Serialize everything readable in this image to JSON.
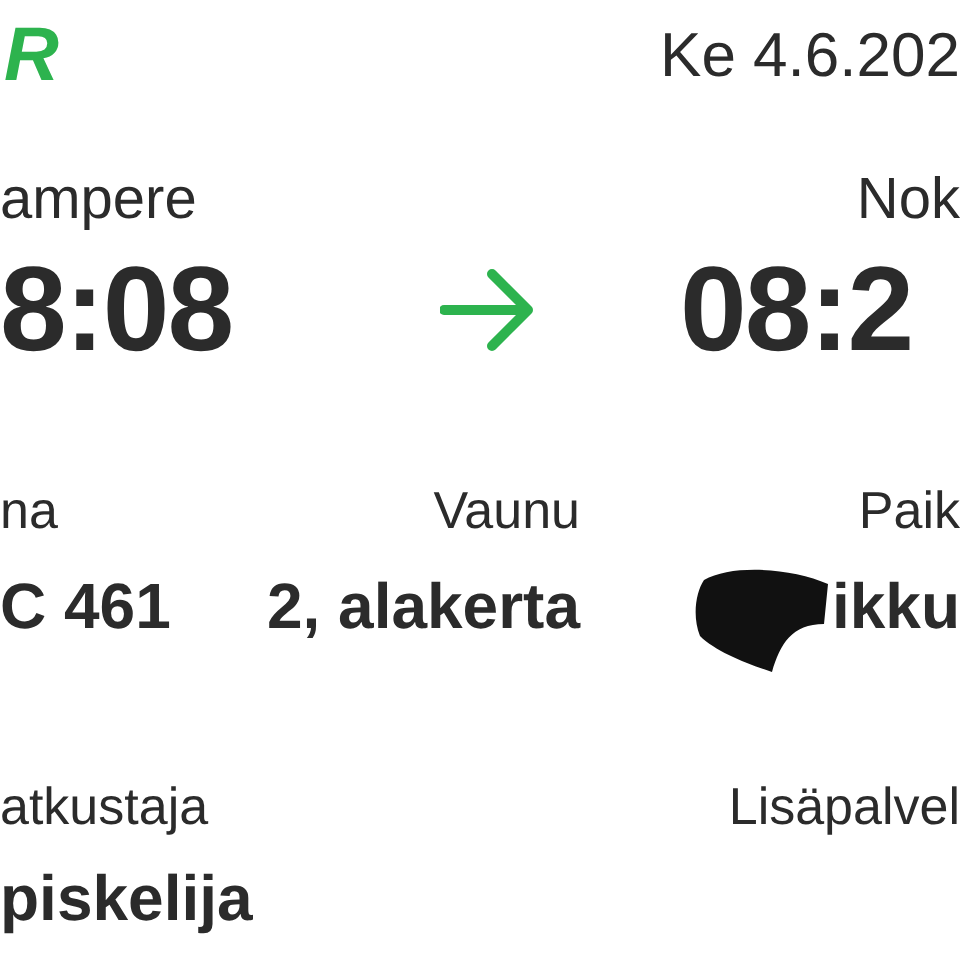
{
  "header": {
    "logo": "R",
    "date": "Ke 4.6.202"
  },
  "route": {
    "from": {
      "station": "ampere",
      "time": "8:08"
    },
    "to": {
      "station": "Nok",
      "time": "08:2"
    }
  },
  "details": [
    {
      "label": "na",
      "value": "C 461",
      "redacted": false
    },
    {
      "label": "Vaunu",
      "value": "2, alakerta",
      "redacted": false
    },
    {
      "label": "Paik",
      "value": "ikku",
      "redacted": true
    }
  ],
  "passenger": {
    "label": "atkustaja",
    "value": "piskelija"
  },
  "extras": {
    "label": "Lisäpalvel"
  }
}
